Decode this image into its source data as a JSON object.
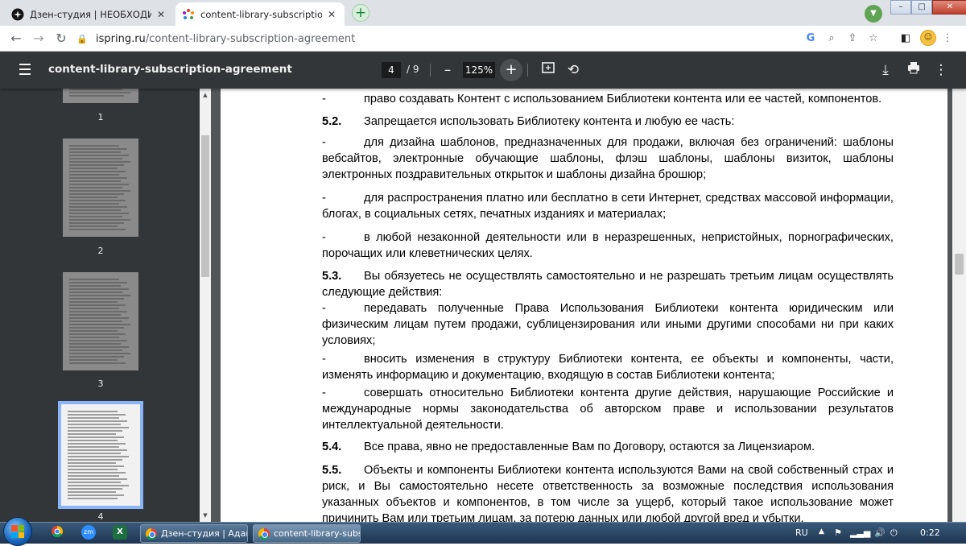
{
  "browser": {
    "tabs": [
      {
        "title": "Дзен-студия | НЕОБХОДИМО ВЫ",
        "active": false
      },
      {
        "title": "content-library-subscription-agreement",
        "active": true
      }
    ],
    "new_tab": "+",
    "url_domain": "ispring.ru",
    "url_path": "/content-library-subscription-agreement",
    "window_controls": [
      "–",
      "□",
      "✕"
    ]
  },
  "pdf_toolbar": {
    "title": "content-library-subscription-agreement",
    "page_current": "4",
    "page_total": "/ 9",
    "zoom": "125%"
  },
  "sidebar": {
    "thumbnail_labels": [
      "1",
      "2",
      "3",
      "4"
    ],
    "selected_page": 4
  },
  "document": {
    "dash": "-",
    "line_top": "право создавать Контент с использованием Библиотеки контента или ее частей, компонентов.",
    "s52_num": "5.2.",
    "s52_text": "Запрещается использовать Библиотеку контента и любую ее часть:",
    "b1": "для дизайна шаблонов, предназначенных для продажи, включая без ограничений: шаблоны вебсайтов, электронные обучающие шаблоны, флэш шаблоны, шаблоны визиток, шаблоны электронных поздравительных открыток и шаблоны дизайна брошюр;",
    "b2": "для распространения платно или бесплатно в сети Интернет, средствах массовой информации, блогах, в социальных сетях, печатных изданиях и материалах;",
    "b3": "в любой незаконной деятельности или в неразрешенных, непристойных, порнографических, порочащих или клеветнических целях.",
    "s53_num": "5.3.",
    "s53_text": "Вы обязуетесь не осуществлять самостоятельно и не разрешать третьим лицам осуществлять следующие действия:",
    "b4": "передавать полученные Права Использования Библиотеки контента юридическим или физическим лицам путем продажи, сублицензирования или иными другими способами ни при каких условиях;",
    "b5": "вносить изменения в структуру Библиотеки контента, ее объекты и компоненты, части, изменять информацию и документацию, входящую в состав Библиотеки контента;",
    "b6": "совершать относительно Библиотеки контента другие действия, нарушающие Российские и международные нормы законодательства об авторском праве и использовании результатов интеллектуальной деятельности.",
    "s54_num": "5.4.",
    "s54_text": "Все права, явно не предоставленные Вам по Договору, остаются за Лицензиаром.",
    "s55_num": "5.5.",
    "s55_text": "Объекты и компоненты Библиотеки контента используются Вами на свой собственный страх и риск, и Вы самостоятельно несете ответственность за возможные последствия использования указанных объектов и компонентов, в том числе за ущерб, который такое использование может причинить Вам или третьим лицам, за потерю данных или любой другой вред и убытки."
  },
  "taskbar": {
    "apps": [
      {
        "title": "Дзен-студия | Адапт..."
      },
      {
        "title": "content-library-subs..."
      }
    ],
    "pinned": [
      "chrome-icon",
      "zoom-icon",
      "excel-icon"
    ],
    "zoom_label": "zm",
    "excel_label": "X",
    "language": "RU",
    "clock": "0:22"
  }
}
